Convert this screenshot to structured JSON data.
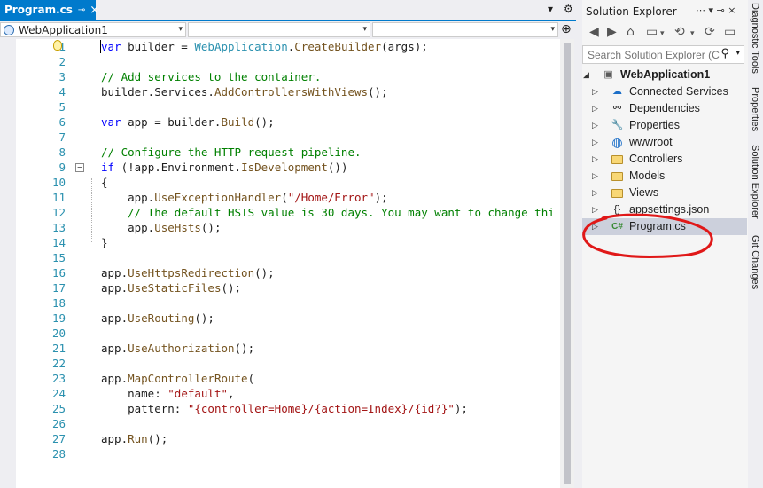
{
  "editor": {
    "tab_title": "Program.cs",
    "tab_pin": "⊸",
    "tab_close": "×",
    "dropdown_glyph": "▾",
    "settings_glyph": "⚙",
    "project_combo": "WebApplication1",
    "split_glyph": "⊕",
    "lines": [
      {
        "n": "1",
        "html": "<span class=\"kw\">var</span> builder = <span class=\"ty\">WebApplication</span>.<span class=\"mt\">CreateBuilder</span>(args);"
      },
      {
        "n": "2",
        "html": ""
      },
      {
        "n": "3",
        "html": "<span class=\"cm\">// Add services to the container.</span>"
      },
      {
        "n": "4",
        "html": "builder.Services.<span class=\"mt\">AddControllersWithViews</span>();"
      },
      {
        "n": "5",
        "html": ""
      },
      {
        "n": "6",
        "html": "<span class=\"kw\">var</span> app = builder.<span class=\"mt\">Build</span>();"
      },
      {
        "n": "7",
        "html": ""
      },
      {
        "n": "8",
        "html": "<span class=\"cm\">// Configure the HTTP request pipeline.</span>"
      },
      {
        "n": "9",
        "html": "<span class=\"kw\">if</span> (!app.Environment.<span class=\"mt\">IsDevelopment</span>())"
      },
      {
        "n": "10",
        "html": "{"
      },
      {
        "n": "11",
        "html": "    app.<span class=\"mt\">UseExceptionHandler</span>(<span class=\"st\">\"/Home/Error\"</span>);"
      },
      {
        "n": "12",
        "html": "    <span class=\"cm\">// The default HSTS value is 30 days. You may want to change thi</span>"
      },
      {
        "n": "13",
        "html": "    app.<span class=\"mt\">UseHsts</span>();"
      },
      {
        "n": "14",
        "html": "}"
      },
      {
        "n": "15",
        "html": ""
      },
      {
        "n": "16",
        "html": "app.<span class=\"mt\">UseHttpsRedirection</span>();"
      },
      {
        "n": "17",
        "html": "app.<span class=\"mt\">UseStaticFiles</span>();"
      },
      {
        "n": "18",
        "html": ""
      },
      {
        "n": "19",
        "html": "app.<span class=\"mt\">UseRouting</span>();"
      },
      {
        "n": "20",
        "html": ""
      },
      {
        "n": "21",
        "html": "app.<span class=\"mt\">UseAuthorization</span>();"
      },
      {
        "n": "22",
        "html": ""
      },
      {
        "n": "23",
        "html": "app.<span class=\"mt\">MapControllerRoute</span>("
      },
      {
        "n": "24",
        "html": "    name: <span class=\"st\">\"default\"</span>,"
      },
      {
        "n": "25",
        "html": "    pattern: <span class=\"st\">\"{controller=Home}/{action=Index}/{id?}\"</span>);"
      },
      {
        "n": "26",
        "html": ""
      },
      {
        "n": "27",
        "html": "app.<span class=\"mt\">Run</span>();"
      },
      {
        "n": "28",
        "html": ""
      }
    ]
  },
  "solution_explorer": {
    "title": "Solution Explorer",
    "title_buttons": "⋯ ▾ ⊸ ×",
    "search_placeholder": "Search Solution Explorer (Ct",
    "search_icon": "⚲",
    "toolbar": [
      "◀",
      "▶",
      "⌂",
      "▭",
      "▾",
      "⟲",
      "▾",
      "⟳",
      "▭"
    ],
    "nodes": [
      {
        "label": "WebApplication1",
        "icon": "project-icon",
        "glyph": "▣",
        "bold": true,
        "expander": "◢",
        "indent": 0,
        "selected": false
      },
      {
        "label": "Connected Services",
        "icon": "connected-services-icon",
        "glyph": "☁",
        "bold": false,
        "expander": "▷",
        "indent": 1,
        "selected": false
      },
      {
        "label": "Dependencies",
        "icon": "dependencies-icon",
        "glyph": "⚯",
        "bold": false,
        "expander": "▷",
        "indent": 1,
        "selected": false
      },
      {
        "label": "Properties",
        "icon": "wrench-icon",
        "glyph": "🔧",
        "bold": false,
        "expander": "▷",
        "indent": 1,
        "selected": false
      },
      {
        "label": "wwwroot",
        "icon": "globe-icon",
        "glyph": "◍",
        "bold": false,
        "expander": "▷",
        "indent": 1,
        "selected": false
      },
      {
        "label": "Controllers",
        "icon": "folder-icon",
        "glyph": "",
        "bold": false,
        "expander": "▷",
        "indent": 1,
        "selected": false
      },
      {
        "label": "Models",
        "icon": "folder-icon",
        "glyph": "",
        "bold": false,
        "expander": "▷",
        "indent": 1,
        "selected": false
      },
      {
        "label": "Views",
        "icon": "folder-icon",
        "glyph": "",
        "bold": false,
        "expander": "▷",
        "indent": 1,
        "selected": false
      },
      {
        "label": "appsettings.json",
        "icon": "json-file-icon",
        "glyph": "{}",
        "bold": false,
        "expander": "▷",
        "indent": 1,
        "selected": false
      },
      {
        "label": "Program.cs",
        "icon": "csharp-file-icon",
        "glyph": "C#",
        "bold": false,
        "expander": "▷",
        "indent": 1,
        "selected": true
      }
    ]
  },
  "side_tabs": [
    "Diagnostic Tools",
    "Properties",
    "Solution Explorer",
    "Git Changes"
  ],
  "colors": {
    "accent": "#007acc",
    "annotation": "#e01818"
  }
}
